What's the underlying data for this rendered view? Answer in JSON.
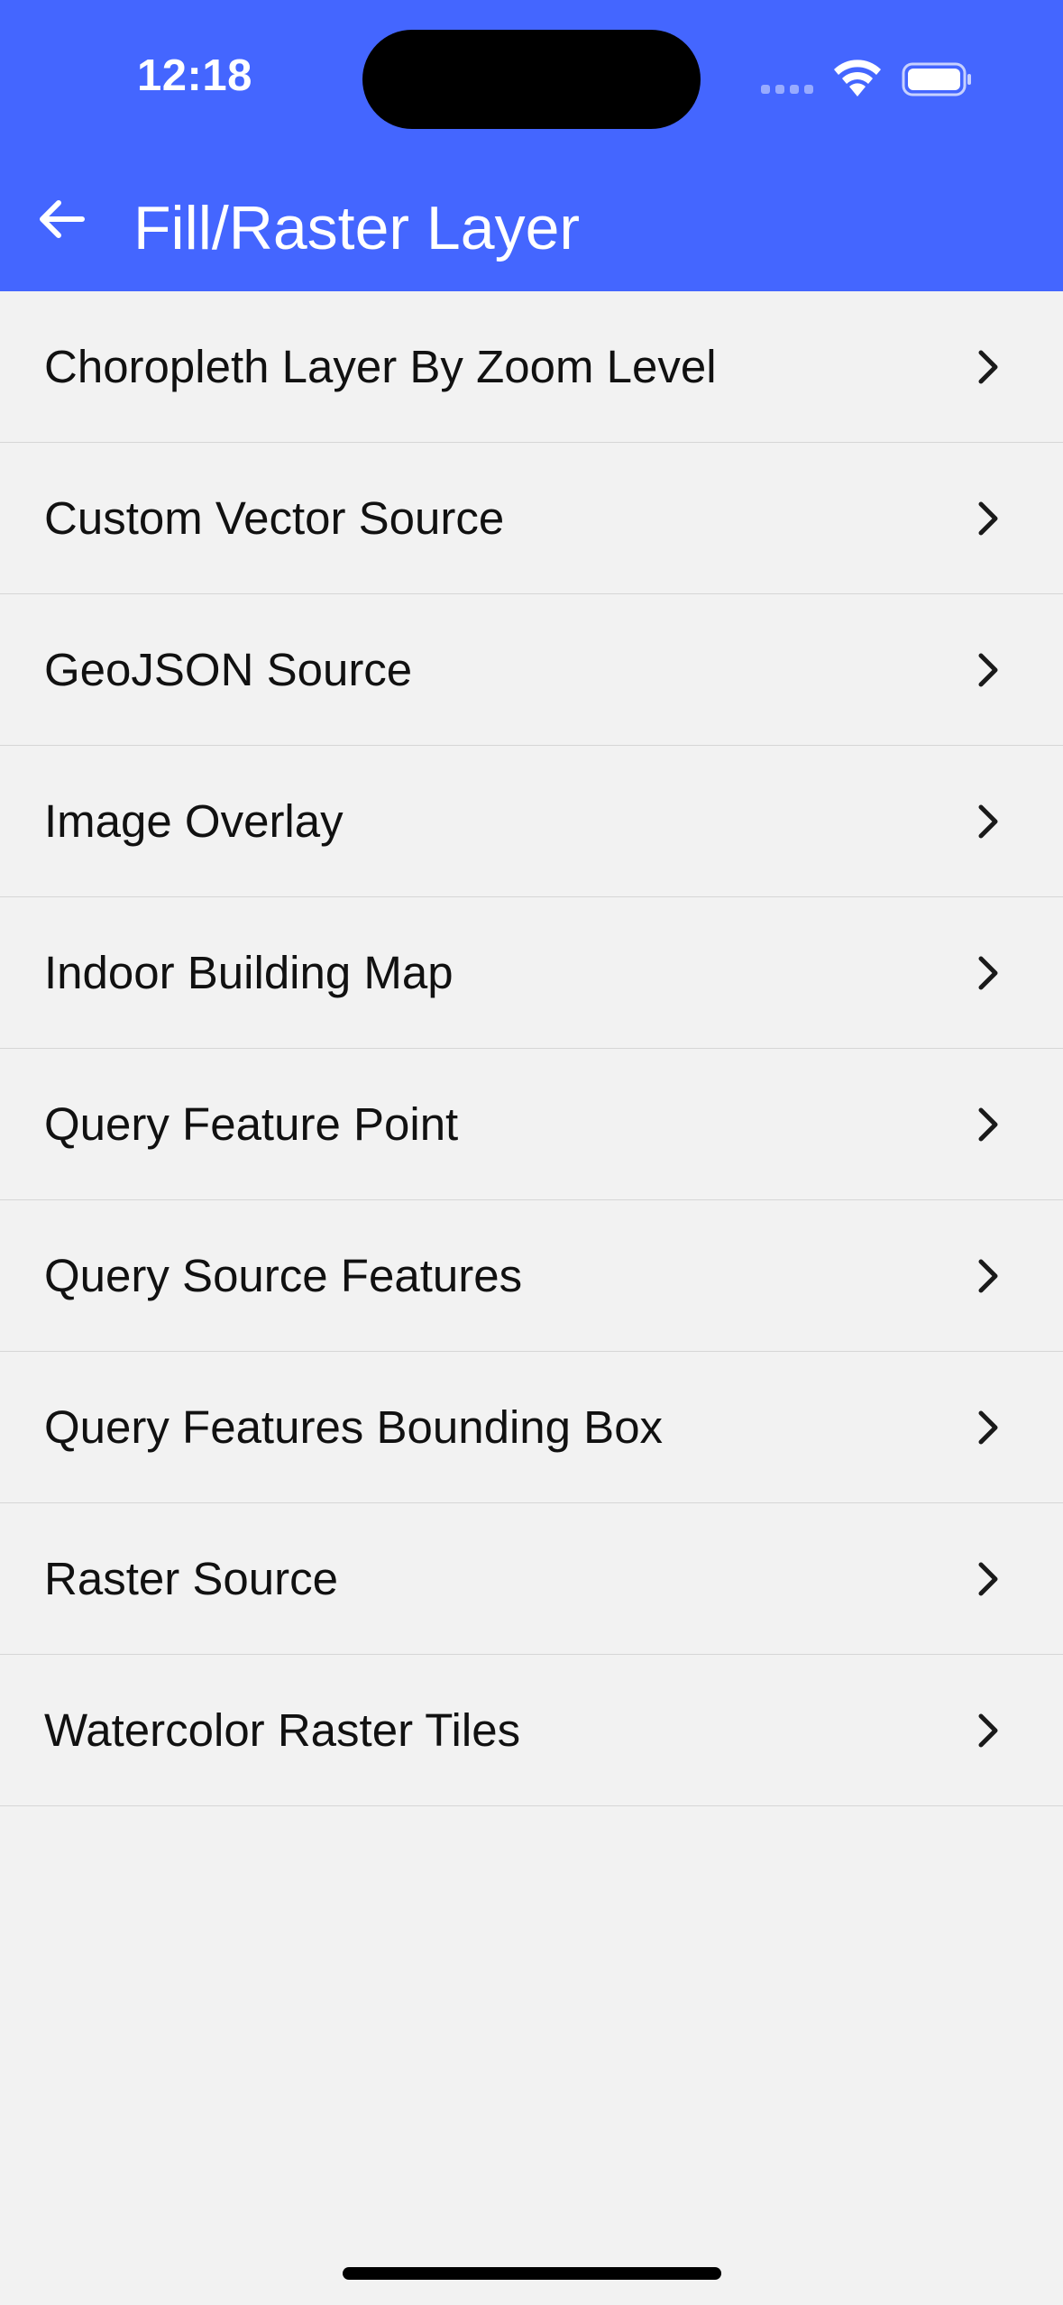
{
  "status_bar": {
    "time": "12:18"
  },
  "header": {
    "title": "Fill/Raster Layer",
    "back_icon": "arrow-left-icon",
    "background_color": "#4466ff"
  },
  "list": {
    "items": [
      {
        "label": "Choropleth Layer By Zoom Level"
      },
      {
        "label": "Custom Vector Source"
      },
      {
        "label": "GeoJSON Source"
      },
      {
        "label": "Image Overlay"
      },
      {
        "label": "Indoor Building Map"
      },
      {
        "label": "Query Feature Point"
      },
      {
        "label": "Query Source Features"
      },
      {
        "label": "Query Features Bounding Box"
      },
      {
        "label": "Raster Source"
      },
      {
        "label": "Watercolor Raster Tiles"
      }
    ],
    "chevron_icon": "chevron-right-icon"
  }
}
